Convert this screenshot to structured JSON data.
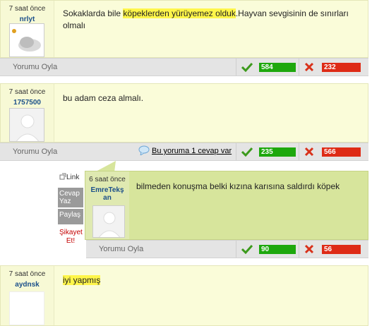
{
  "comments": [
    {
      "time": "7 saat önce",
      "user": "nrlyt",
      "text_pre": "Sokaklarda bile ",
      "text_hl": "köpeklerden yürüyemez olduk",
      "text_post": ".Hayvan sevgisinin de sınırları olmalı",
      "vote_label": "Yorumu Oyla",
      "up": "584",
      "down": "232"
    },
    {
      "time": "7 saat önce",
      "user": "1757500",
      "text": "bu adam ceza almalı.",
      "reply_link": "Bu yoruma 1 cevap var",
      "vote_label": "Yorumu Oyla",
      "up": "235",
      "down": "566"
    },
    {
      "time": "7 saat önce",
      "user": "aydnsk",
      "text_hl": "iyi yapmış"
    }
  ],
  "reply": {
    "time": "6 saat önce",
    "user": "EmreTekşan",
    "text": "bilmeden konuşma belki kızına karısına saldırdı köpek",
    "vote_label": "Yorumu Oyla",
    "up": "90",
    "down": "56"
  },
  "actions": {
    "link": "Link",
    "reply": "Cevap Yaz",
    "share": "Paylaş",
    "report": "Şikayet Et!"
  },
  "colors": {
    "comment_bg": "#fafcd9",
    "reply_bg": "#d7e59c",
    "up": "#1ea80d",
    "down": "#de2b16",
    "highlight": "#fff64a"
  },
  "icons": [
    "check-icon",
    "cross-icon",
    "speech-bubble-icon",
    "link-icon",
    "user-avatar-icon"
  ]
}
